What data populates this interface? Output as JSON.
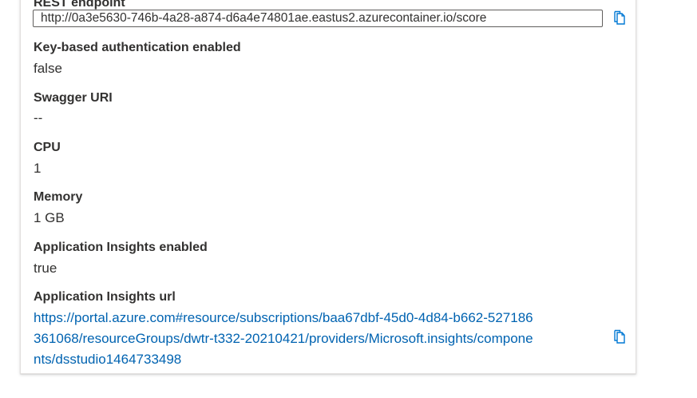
{
  "details": {
    "rest_endpoint_label": "REST endpoint",
    "rest_endpoint_value": "http://0a3e5630-746b-4a28-a874-d6a4e74801ae.eastus2.azurecontainer.io/score",
    "key_auth_label": "Key-based authentication enabled",
    "key_auth_value": "false",
    "swagger_label": "Swagger URI",
    "swagger_value": "--",
    "cpu_label": "CPU",
    "cpu_value": "1",
    "memory_label": "Memory",
    "memory_value": "1 GB",
    "app_insights_enabled_label": "Application Insights enabled",
    "app_insights_enabled_value": "true",
    "app_insights_url_label": "Application Insights url",
    "app_insights_url_lines": [
      "https://portal.azure.com#resource/subscriptions/baa67dbf-45d0-4d84-b662-527186",
      "361068/resourceGroups/dwtr-t332-20210421/providers/Microsoft.insights/compone",
      "nts/dsstudio1464733498"
    ]
  },
  "icons": {
    "copy": "copy-icon"
  },
  "colors": {
    "link": "#0063b1",
    "icon": "#0078d4",
    "text": "#323130"
  }
}
